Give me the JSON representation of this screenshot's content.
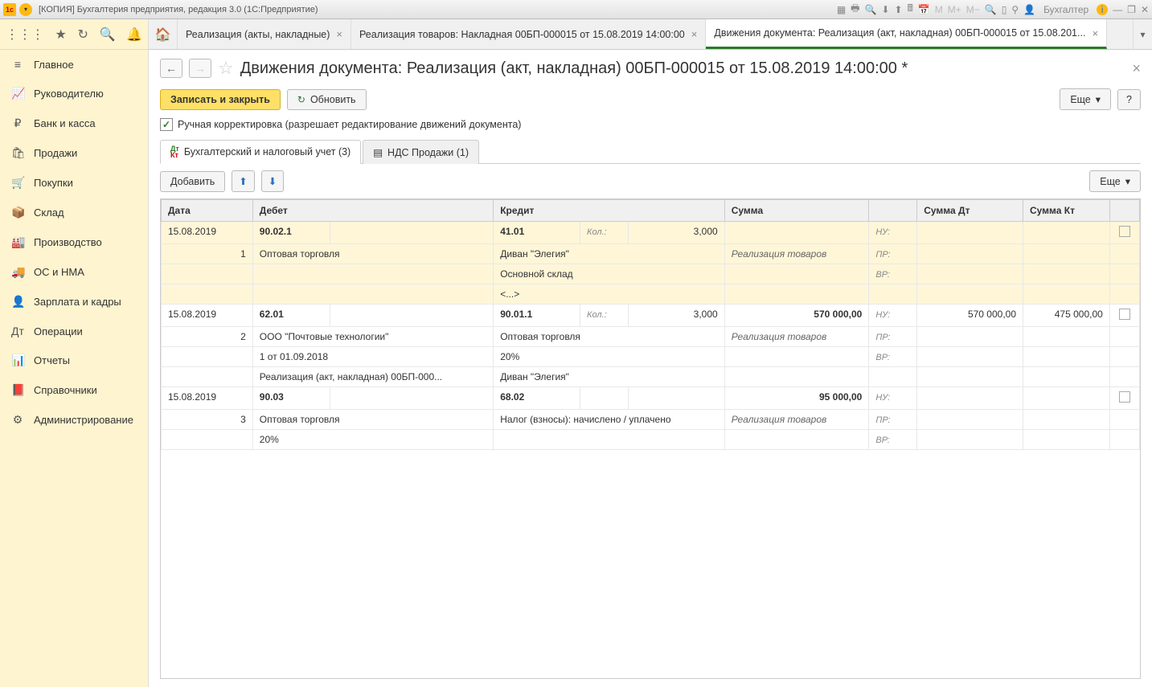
{
  "titlebar": {
    "app_title": "[КОПИЯ] Бухгалтерия предприятия, редакция 3.0  (1С:Предприятие)",
    "user_label": "Бухгалтер"
  },
  "sidebar": {
    "items": [
      {
        "icon": "≡",
        "label": "Главное"
      },
      {
        "icon": "📈",
        "label": "Руководителю"
      },
      {
        "icon": "₽",
        "label": "Банк и касса"
      },
      {
        "icon": "🛍",
        "label": "Продажи"
      },
      {
        "icon": "🛒",
        "label": "Покупки"
      },
      {
        "icon": "📦",
        "label": "Склад"
      },
      {
        "icon": "🏭",
        "label": "Производство"
      },
      {
        "icon": "🚚",
        "label": "ОС и НМА"
      },
      {
        "icon": "👤",
        "label": "Зарплата и кадры"
      },
      {
        "icon": "Дт",
        "label": "Операции"
      },
      {
        "icon": "📊",
        "label": "Отчеты"
      },
      {
        "icon": "📕",
        "label": "Справочники"
      },
      {
        "icon": "⚙",
        "label": "Администрирование"
      }
    ]
  },
  "tabs": [
    {
      "label": "Реализация (акты, накладные)",
      "active": false
    },
    {
      "label": "Реализация товаров: Накладная 00БП-000015 от 15.08.2019 14:00:00",
      "active": false
    },
    {
      "label": "Движения документа: Реализация (акт, накладная) 00БП-000015 от 15.08.201...",
      "active": true
    }
  ],
  "doc": {
    "title": "Движения документа: Реализация (акт, накладная) 00БП-000015 от 15.08.2019 14:00:00 *"
  },
  "commands": {
    "save_close": "Записать и закрыть",
    "refresh": "Обновить",
    "more": "Еще",
    "help": "?"
  },
  "manual_edit": {
    "checked": true,
    "label": "Ручная корректировка (разрешает редактирование движений документа)"
  },
  "subtabs": [
    {
      "label": "Бухгалтерский и налоговый учет (3)",
      "active": true
    },
    {
      "label": "НДС Продажи (1)",
      "active": false
    }
  ],
  "table_cmd": {
    "add": "Добавить",
    "more": "Еще"
  },
  "columns": {
    "date": "Дата",
    "debit": "Дебет",
    "credit": "Кредит",
    "sum": "Сумма",
    "sum_dt": "Сумма Дт",
    "sum_kt": "Сумма Кт"
  },
  "labels": {
    "kol": "Кол.:",
    "nu": "НУ:",
    "pr": "ПР:",
    "vr": "ВР:",
    "ellipsis": "<...>"
  },
  "rows": [
    {
      "n": "1",
      "date": "15.08.2019",
      "highlight": true,
      "debit_acc": "90.02.1",
      "debit_l1": "Оптовая торговля",
      "debit_l2": "",
      "debit_l3": "",
      "credit_acc": "41.01",
      "credit_kol": "3,000",
      "credit_l1": "Диван \"Элегия\"",
      "credit_l2": "Основной склад",
      "credit_l3": "<...>",
      "sum": "",
      "sum_note": "Реализация товаров",
      "sum_dt": "",
      "sum_kt": ""
    },
    {
      "n": "2",
      "date": "15.08.2019",
      "highlight": false,
      "debit_acc": "62.01",
      "debit_l1": "ООО \"Почтовые  технологии\"",
      "debit_l2": "1 от 01.09.2018",
      "debit_l3": "Реализация (акт, накладная) 00БП-000...",
      "credit_acc": "90.01.1",
      "credit_kol": "3,000",
      "credit_l1": "Оптовая торговля",
      "credit_l2": "20%",
      "credit_l3": "Диван \"Элегия\"",
      "sum": "570 000,00",
      "sum_note": "Реализация товаров",
      "sum_dt": "570 000,00",
      "sum_kt": "475 000,00"
    },
    {
      "n": "3",
      "date": "15.08.2019",
      "highlight": false,
      "debit_acc": "90.03",
      "debit_l1": "Оптовая торговля",
      "debit_l2": "20%",
      "debit_l3": "",
      "credit_acc": "68.02",
      "credit_kol": "",
      "credit_l1": "Налог (взносы): начислено / уплачено",
      "credit_l2": "",
      "credit_l3": "",
      "sum": "95 000,00",
      "sum_note": "Реализация товаров",
      "sum_dt": "",
      "sum_kt": ""
    }
  ]
}
